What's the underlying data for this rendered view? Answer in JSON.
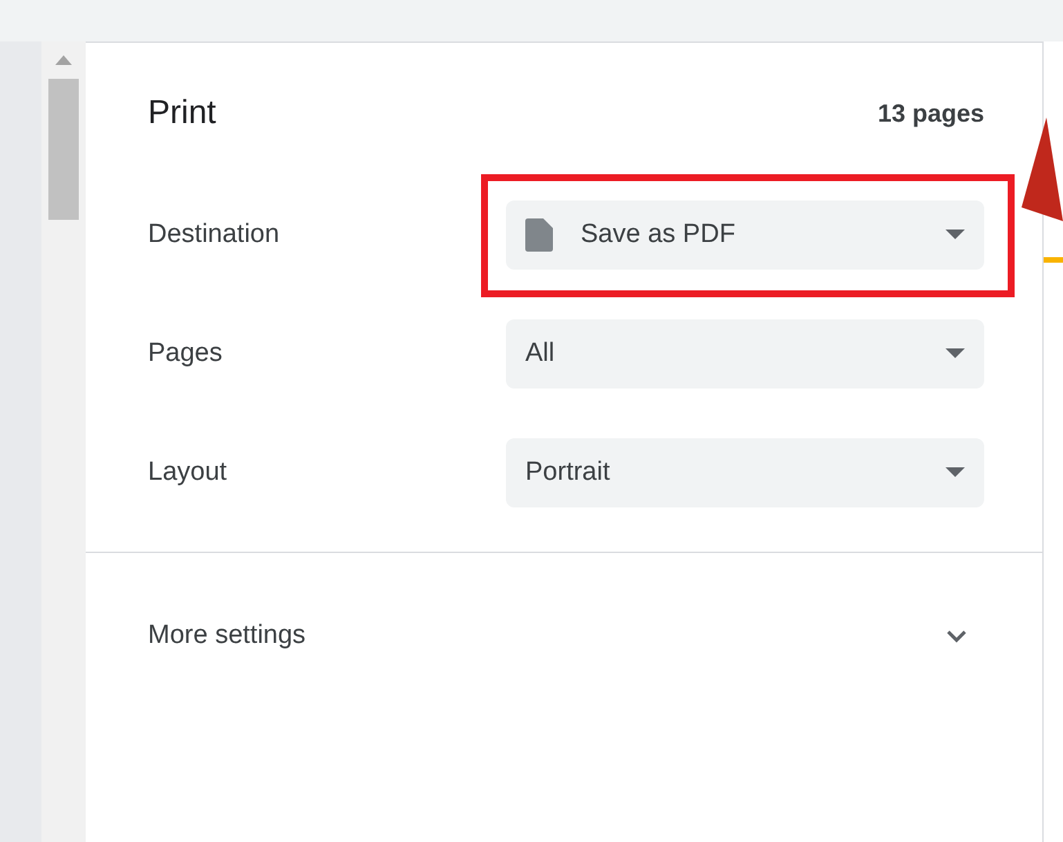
{
  "dialog": {
    "title": "Print",
    "page_count": "13 pages"
  },
  "settings": [
    {
      "label": "Destination",
      "value": "Save as PDF",
      "kind": "destination",
      "highlighted": true
    },
    {
      "label": "Pages",
      "value": "All",
      "kind": "plain",
      "highlighted": false
    },
    {
      "label": "Layout",
      "value": "Portrait",
      "kind": "plain",
      "highlighted": false
    }
  ],
  "more_settings": {
    "label": "More settings",
    "expanded": false
  }
}
